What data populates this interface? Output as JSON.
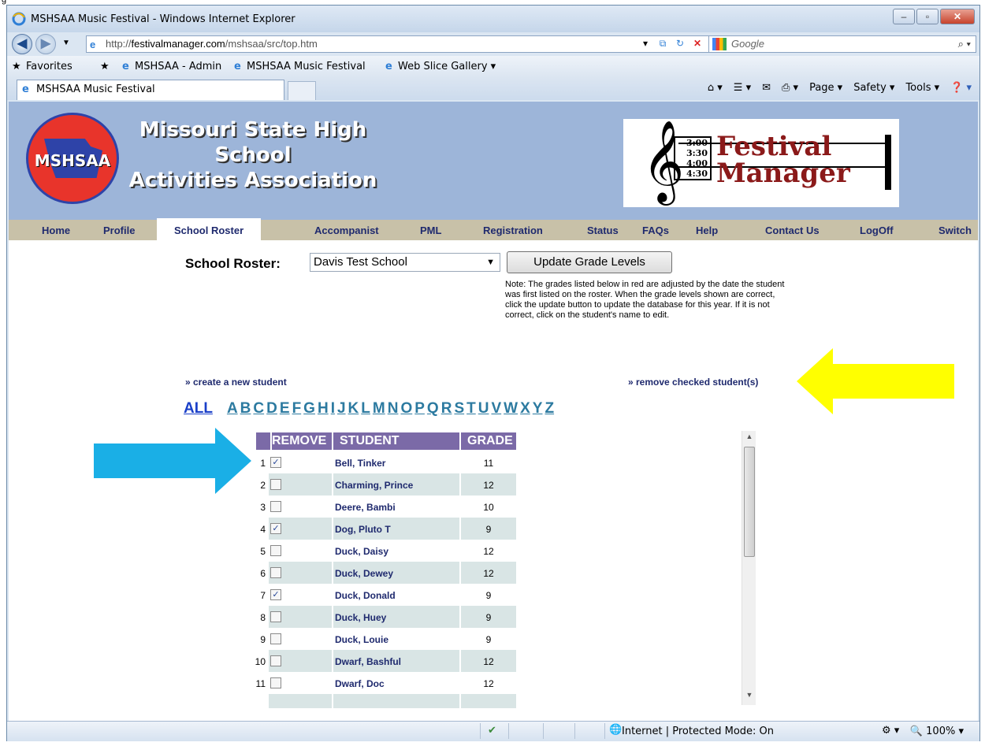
{
  "top_caption": "g",
  "window": {
    "title": "MSHSAA Music Festival - Windows Internet Explorer"
  },
  "address": {
    "url_prefix": "http://",
    "url_domain": "festivalmanager.com",
    "url_path": "/mshsaa/src/top.htm",
    "search_placeholder": "Google"
  },
  "favorites": {
    "label": "Favorites",
    "items": [
      "MSHSAA - Admin",
      "MSHSAA Music Festival",
      "Web Slice Gallery ▾"
    ]
  },
  "tab": {
    "label": "MSHSAA Music Festival"
  },
  "commandbar": [
    "Page ▾",
    "Safety ▾",
    "Tools ▾"
  ],
  "banner": {
    "logo_text": "MSHSAA",
    "org_line1": "Missouri State High School",
    "org_line2": "Activities Association",
    "times": [
      "3:00",
      "3:30",
      "4:00",
      "4:30"
    ],
    "product_line1": "Festival",
    "product_line2": "Manager"
  },
  "menu": [
    "Home",
    "Profile",
    "School Roster",
    "Accompanist",
    "PML",
    "Registration",
    "Status",
    "FAQs",
    "Help",
    "Contact Us",
    "LogOff",
    "Switch"
  ],
  "roster": {
    "label": "School Roster:",
    "school": "Davis Test School",
    "update_button": "Update Grade Levels",
    "note": "Note: The grades listed below in red are adjusted by the date the student was first listed on the roster. When the grade levels shown are correct, click the update button to update the database for this year. If it is not correct, click on the student's name to edit.",
    "create_link": "» create a new student",
    "remove_link": "» remove checked student(s)",
    "all_label": "ALL",
    "letters": [
      "A",
      "B",
      "C",
      "D",
      "E",
      "F",
      "G",
      "H",
      "I",
      "J",
      "K",
      "L",
      "M",
      "N",
      "O",
      "P",
      "Q",
      "R",
      "S",
      "T",
      "U",
      "V",
      "W",
      "X",
      "Y",
      "Z"
    ]
  },
  "table": {
    "headers": {
      "remove": "REMOVE",
      "student": "STUDENT",
      "grade": "GRADE"
    },
    "rows": [
      {
        "num": "1",
        "checked": true,
        "name": "Bell, Tinker",
        "grade": "11"
      },
      {
        "num": "2",
        "checked": false,
        "name": "Charming, Prince",
        "grade": "12"
      },
      {
        "num": "3",
        "checked": false,
        "name": "Deere, Bambi",
        "grade": "10"
      },
      {
        "num": "4",
        "checked": true,
        "name": "Dog, Pluto T",
        "grade": "9"
      },
      {
        "num": "5",
        "checked": false,
        "name": "Duck, Daisy",
        "grade": "12"
      },
      {
        "num": "6",
        "checked": false,
        "name": "Duck, Dewey",
        "grade": "12"
      },
      {
        "num": "7",
        "checked": true,
        "name": "Duck, Donald",
        "grade": "9"
      },
      {
        "num": "8",
        "checked": false,
        "name": "Duck, Huey",
        "grade": "9"
      },
      {
        "num": "9",
        "checked": false,
        "name": "Duck, Louie",
        "grade": "9"
      },
      {
        "num": "10",
        "checked": false,
        "name": "Dwarf, Bashful",
        "grade": "12"
      },
      {
        "num": "11",
        "checked": false,
        "name": "Dwarf, Doc",
        "grade": "12"
      }
    ]
  },
  "status": {
    "zone": "Internet | Protected Mode: On",
    "zoom": "100%"
  },
  "colors": {
    "banner": "#9db5d9",
    "menu_bg": "#c8c1a8",
    "header_purple": "#7b6aa7",
    "row_alt": "#d9e5e5",
    "link_navy": "#1f2a6e",
    "arrow_yellow": "#ffff00",
    "arrow_blue": "#1aafe6"
  }
}
